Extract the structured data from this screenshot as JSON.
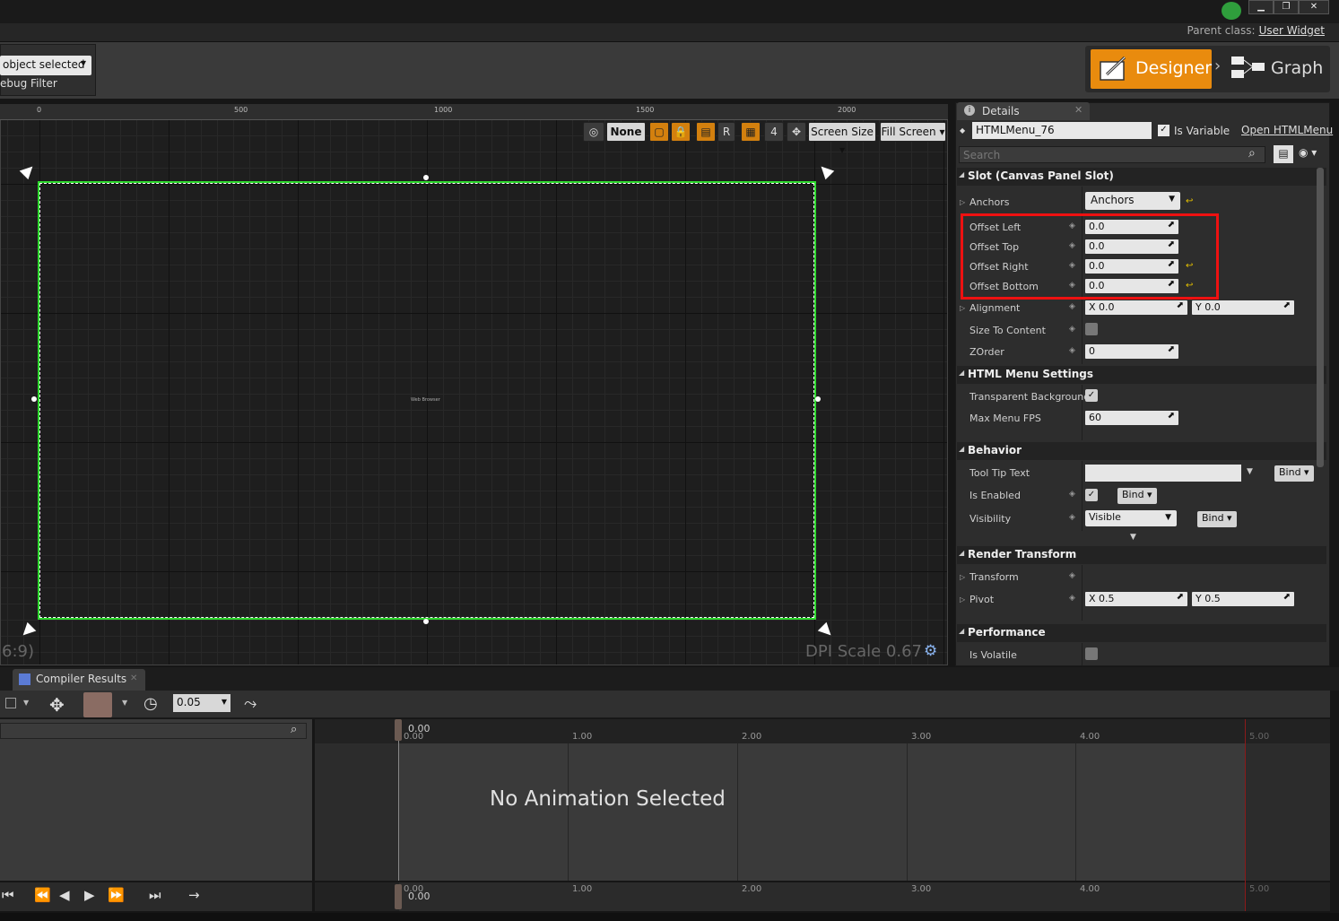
{
  "window": {
    "minimize": "▁",
    "restore": "❐",
    "close": "✕",
    "parent_class_label": "Parent class:",
    "parent_class_value": "User Widget"
  },
  "toolbar": {
    "object_selector": "object selected",
    "debug_filter": "ebug Filter",
    "designer_label": "Designer",
    "graph_label": "Graph"
  },
  "viewport": {
    "ruler_labels": [
      "0",
      "500",
      "1000",
      "1500",
      "2000"
    ],
    "localization": "None",
    "r_button": "R",
    "grid_snap": "4",
    "screen_size": "Screen Size",
    "fill_screen": "Fill Screen",
    "widget_label": "Web Browser",
    "aspect": "6:9)",
    "dpi_scale": "DPI Scale 0.67"
  },
  "details": {
    "tab_label": "Details",
    "widget_name": "HTMLMenu_76",
    "is_variable_label": "Is Variable",
    "open_link": "Open HTMLMenu",
    "search_placeholder": "Search",
    "slot_section": "Slot (Canvas Panel Slot)",
    "anchors_label": "Anchors",
    "anchors_value": "Anchors",
    "offset_left_label": "Offset Left",
    "offset_left": "0.0",
    "offset_top_label": "Offset Top",
    "offset_top": "0.0",
    "offset_right_label": "Offset Right",
    "offset_right": "0.0",
    "offset_bottom_label": "Offset Bottom",
    "offset_bottom": "0.0",
    "alignment_label": "Alignment",
    "alignment_x": "X  0.0",
    "alignment_y": "Y  0.0",
    "size_to_content_label": "Size To Content",
    "zorder_label": "ZOrder",
    "zorder": "0",
    "html_section": "HTML Menu Settings",
    "transparent_bg_label": "Transparent Background",
    "max_fps_label": "Max Menu FPS",
    "max_fps": "60",
    "behavior_section": "Behavior",
    "tooltip_label": "Tool Tip Text",
    "is_enabled_label": "Is Enabled",
    "visibility_label": "Visibility",
    "visibility_value": "Visible",
    "bind": "Bind",
    "render_section": "Render Transform",
    "transform_label": "Transform",
    "pivot_label": "Pivot",
    "pivot_x": "X  0.5",
    "pivot_y": "Y  0.5",
    "performance_section": "Performance",
    "is_volatile_label": "Is Volatile"
  },
  "bottom": {
    "compiler_tab": "Compiler Results",
    "snap_interval": "0.05",
    "no_animation": "No Animation Selected",
    "timeline_labels": [
      "0.00",
      "1.00",
      "2.00",
      "3.00",
      "4.00",
      "5.00"
    ],
    "playhead_value": "0.00"
  },
  "colors": {
    "accent": "#e98b0e",
    "selection": "#2ed82e",
    "highlight": "#ee1111"
  }
}
